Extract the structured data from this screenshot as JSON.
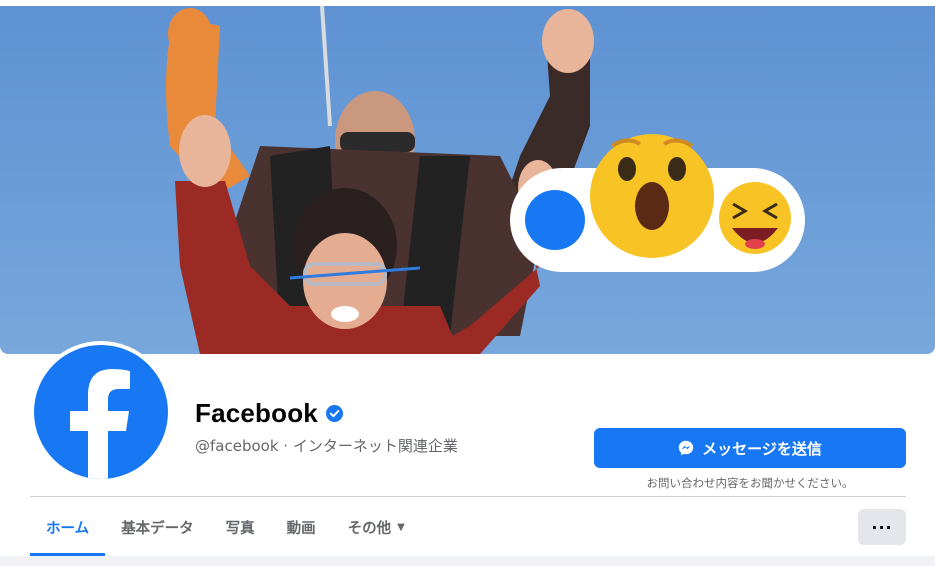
{
  "cover": {
    "image": "cover-photo-skydivers-with-reactions"
  },
  "profile": {
    "name": "Facebook",
    "verified_icon": "verified-badge-icon",
    "handle": "@facebook · インターネット関連企業"
  },
  "actions": {
    "message_label": "メッセージを送信",
    "message_icon": "messenger-icon",
    "message_note": "お問い合わせ内容をお聞かせください。",
    "more_label": "···"
  },
  "tabs": [
    {
      "label": "ホーム",
      "active": true
    },
    {
      "label": "基本データ"
    },
    {
      "label": "写真"
    },
    {
      "label": "動画"
    },
    {
      "label": "その他"
    }
  ],
  "colors": {
    "brand": "#1877f2",
    "text_secondary": "#65676b",
    "button_gray": "#e4e6eb"
  }
}
